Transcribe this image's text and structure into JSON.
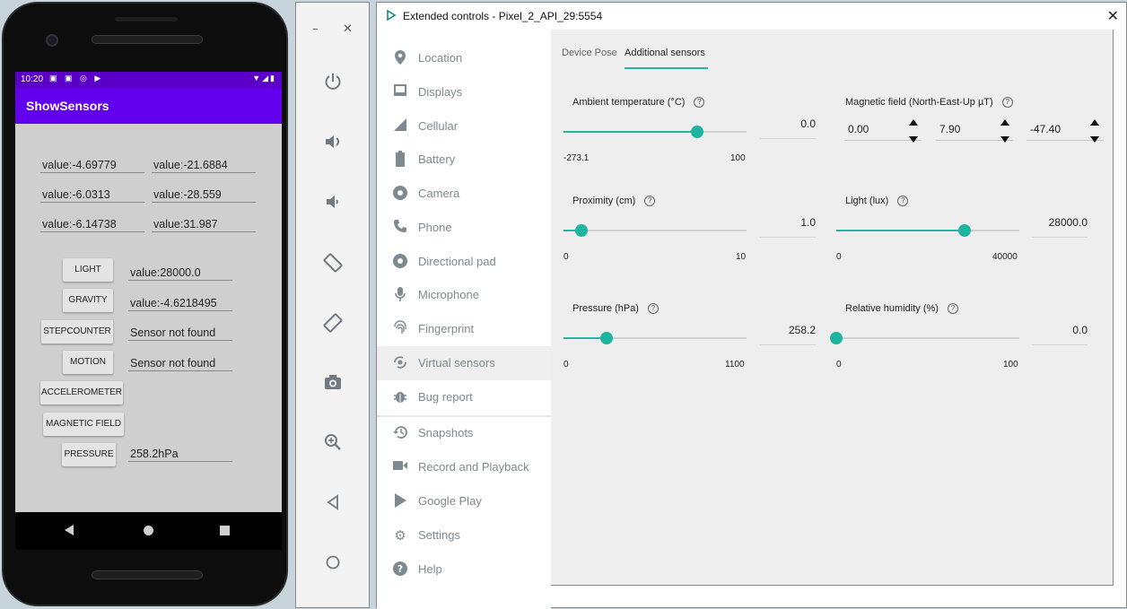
{
  "phone": {
    "status_time": "10:20",
    "status_icons": "▣ ▣ ◎ ▶",
    "status_right": "▼◢▮",
    "app_title": "ShowSensors",
    "rows": [
      [
        "value:-4.69779",
        "value:-21.6884"
      ],
      [
        "value:-6.0313",
        "value:-28.559"
      ],
      [
        "value:-6.14738",
        "value:31.987"
      ]
    ],
    "buttons": {
      "light": "LIGHT",
      "gravity": "GRAVITY",
      "stepcounter": "STEPCOUNTER",
      "motion": "MOTION",
      "accelerometer": "ACCELEROMETER",
      "magnetic_field": "MAGNETIC FIELD",
      "pressure": "PRESSURE"
    },
    "values": {
      "light": "value:28000.0",
      "gravity": "value:-4.6218495",
      "stepcounter": "Sensor not found",
      "motion": "Sensor not found",
      "pressure": "258.2hPa"
    }
  },
  "toolbar": {
    "minimize": "–",
    "close": "✕",
    "icons": [
      "power-icon",
      "volume-up-icon",
      "volume-down-icon",
      "rotate-left-icon",
      "rotate-right-icon",
      "camera-icon",
      "zoom-icon",
      "back-icon",
      "home-icon"
    ]
  },
  "window": {
    "title": "Extended controls - Pixel_2_API_29:5554",
    "close": "✕"
  },
  "sidebar": {
    "items": [
      {
        "label": "Location",
        "icon": "location-pin-icon"
      },
      {
        "label": "Displays",
        "icon": "display-icon"
      },
      {
        "label": "Cellular",
        "icon": "cellular-icon"
      },
      {
        "label": "Battery",
        "icon": "battery-icon"
      },
      {
        "label": "Camera",
        "icon": "camera-aperture-icon"
      },
      {
        "label": "Phone",
        "icon": "phone-icon"
      },
      {
        "label": "Directional pad",
        "icon": "dpad-icon"
      },
      {
        "label": "Microphone",
        "icon": "microphone-icon"
      },
      {
        "label": "Fingerprint",
        "icon": "fingerprint-icon"
      },
      {
        "label": "Virtual sensors",
        "icon": "virtual-sensors-icon"
      },
      {
        "label": "Bug report",
        "icon": "bug-icon"
      },
      {
        "label": "Snapshots",
        "icon": "history-icon"
      },
      {
        "label": "Record and Playback",
        "icon": "video-icon"
      },
      {
        "label": "Google Play",
        "icon": "play-store-icon"
      },
      {
        "label": "Settings",
        "icon": "gear-icon"
      },
      {
        "label": "Help",
        "icon": "help-icon"
      }
    ],
    "active": "Virtual sensors"
  },
  "tabs": {
    "device_pose": "Device Pose",
    "additional_sensors": "Additional sensors",
    "active": "Additional sensors"
  },
  "sensors": {
    "ambient": {
      "label": "Ambient temperature (°C)",
      "value": "0.0",
      "min": "-273.1",
      "max": "100",
      "fraction": 0.732
    },
    "magnetic": {
      "label": "Magnetic field (North-East-Up µT)",
      "x": "0.00",
      "y": "7.90",
      "z": "-47.40"
    },
    "proximity": {
      "label": "Proximity (cm)",
      "value": "1.0",
      "min": "0",
      "max": "10",
      "fraction": 0.1
    },
    "light": {
      "label": "Light (lux)",
      "value": "28000.0",
      "min": "0",
      "max": "40000",
      "fraction": 0.7
    },
    "pressure": {
      "label": "Pressure (hPa)",
      "value": "258.2",
      "min": "0",
      "max": "1100",
      "fraction": 0.235
    },
    "humidity": {
      "label": "Relative humidity (%)",
      "value": "0.0",
      "min": "0",
      "max": "100",
      "fraction": 0.0
    }
  },
  "colors": {
    "accent": "#26b5a0",
    "app_bar": "#6200ee",
    "status_bar": "#5b00c9"
  }
}
